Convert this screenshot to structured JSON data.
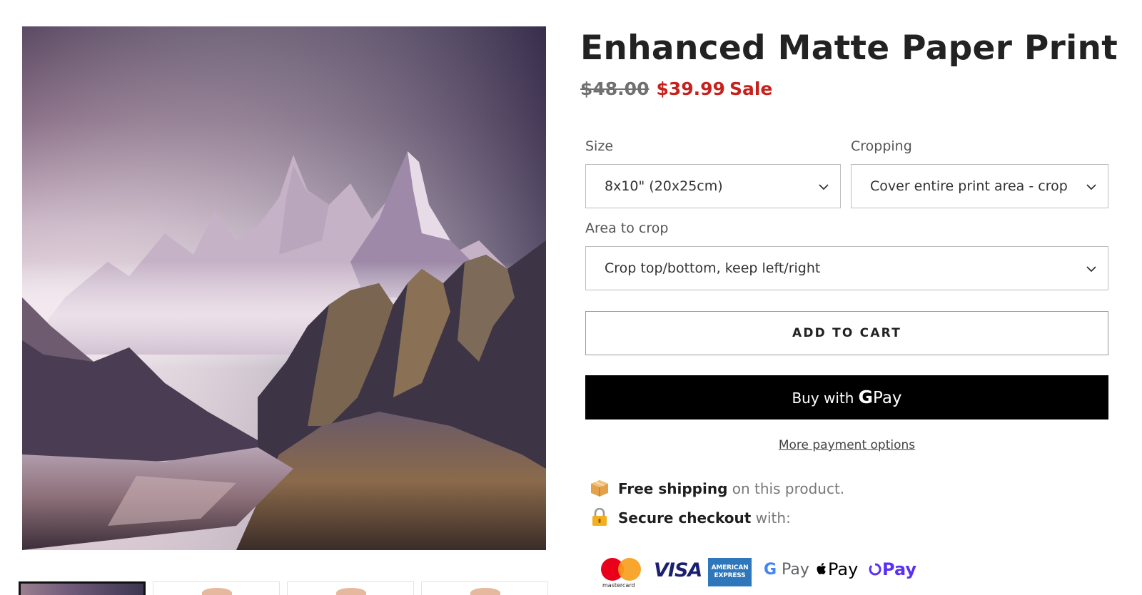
{
  "gallery": {
    "main_image_alt": "Misty purple mountain landscape with river valley",
    "thumbnail_count": 4,
    "active_thumbnail": 1
  },
  "product": {
    "title": "Enhanced Matte Paper Print",
    "price_original": "$48.00",
    "price_sale": "$39.99",
    "sale_label": "Sale"
  },
  "options": {
    "size": {
      "label": "Size",
      "value": "8x10\" (20x25cm)"
    },
    "cropping": {
      "label": "Cropping",
      "value": "Cover entire print area - crop"
    },
    "area_to_crop": {
      "label": "Area to crop",
      "value": "Crop top/bottom, keep left/right"
    }
  },
  "buttons": {
    "add_to_cart": "ADD TO CART",
    "buy_with_prefix": "Buy with",
    "buy_with_brand_g": "G",
    "buy_with_brand_pay": "Pay",
    "more_payment_options": "More payment options"
  },
  "info": {
    "shipping_strong": "Free shipping",
    "shipping_rest": " on this product.",
    "secure_strong": "Secure checkout",
    "secure_rest": " with:"
  },
  "payment_methods": {
    "mastercard": "mastercard",
    "visa": "VISA",
    "amex_line1": "AMERICAN",
    "amex_line2": "EXPRESS",
    "gpay_g": "G",
    "gpay_pay": " Pay",
    "apple_pay": "Pay",
    "shop_pay": "Pay"
  },
  "colors": {
    "sale_red": "#c8211c",
    "buy_button_bg": "#000000",
    "shop_pay_purple": "#5a31f4"
  }
}
